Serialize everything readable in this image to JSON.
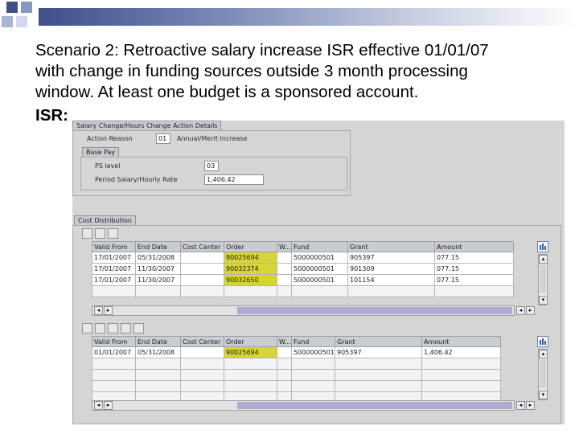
{
  "slide": {
    "heading_lines": [
      "Scenario 2: Retroactive salary increase ISR effective 01/01/07",
      "with change in funding sources outside 3 month processing",
      "window.  At least one budget is a sponsored account."
    ],
    "isr_label": "ISR:"
  },
  "salary_details": {
    "group_title": "Salary Change/Hours Change Action Details",
    "action_reason_label": "Action Reason",
    "action_reason_code": "01",
    "action_reason_text": "Annual/Merit Increase",
    "base_pay_title": "Base Pay",
    "ps_level_label": "PS level",
    "ps_level_value": "03",
    "period_salary_label": "Period Salary/Hourly Rate",
    "period_salary_value": "1,406.42"
  },
  "cost_distribution": {
    "group_title": "Cost Distribution",
    "table1": {
      "columns": [
        "Valid From",
        "End Date",
        "Cost Center",
        "Order",
        "W...",
        "Fund",
        "Grant",
        "Amount"
      ],
      "rows": [
        [
          "17/01/2007",
          "05/31/2008",
          "",
          "90025694",
          "",
          "5000000501",
          "905397",
          "077.15"
        ],
        [
          "17/01/2007",
          "11/30/2007",
          "",
          "90032374",
          "",
          "5000000501",
          "901309",
          "077.15"
        ],
        [
          "17/01/2007",
          "11/30/2007",
          "",
          "90032650",
          "",
          "5000000501",
          "101154",
          "077.15"
        ]
      ]
    },
    "table2": {
      "columns": [
        "Valid From",
        "End Date",
        "Cost Center",
        "Order",
        "W...",
        "Fund",
        "Grant",
        "Amount"
      ],
      "rows": [
        [
          "01/01/2007",
          "05/31/2008",
          "",
          "90025694",
          "",
          "5000000501",
          "905397",
          "1,406.42"
        ]
      ]
    }
  },
  "colors": {
    "highlight": "#d6d436",
    "scroll_thumb": "#b3a8cf",
    "header_bar": "#3e4f8a"
  },
  "icons": {
    "scroll_left": "◂",
    "scroll_right": "▸",
    "scroll_up": "▴",
    "scroll_down": "▾"
  }
}
